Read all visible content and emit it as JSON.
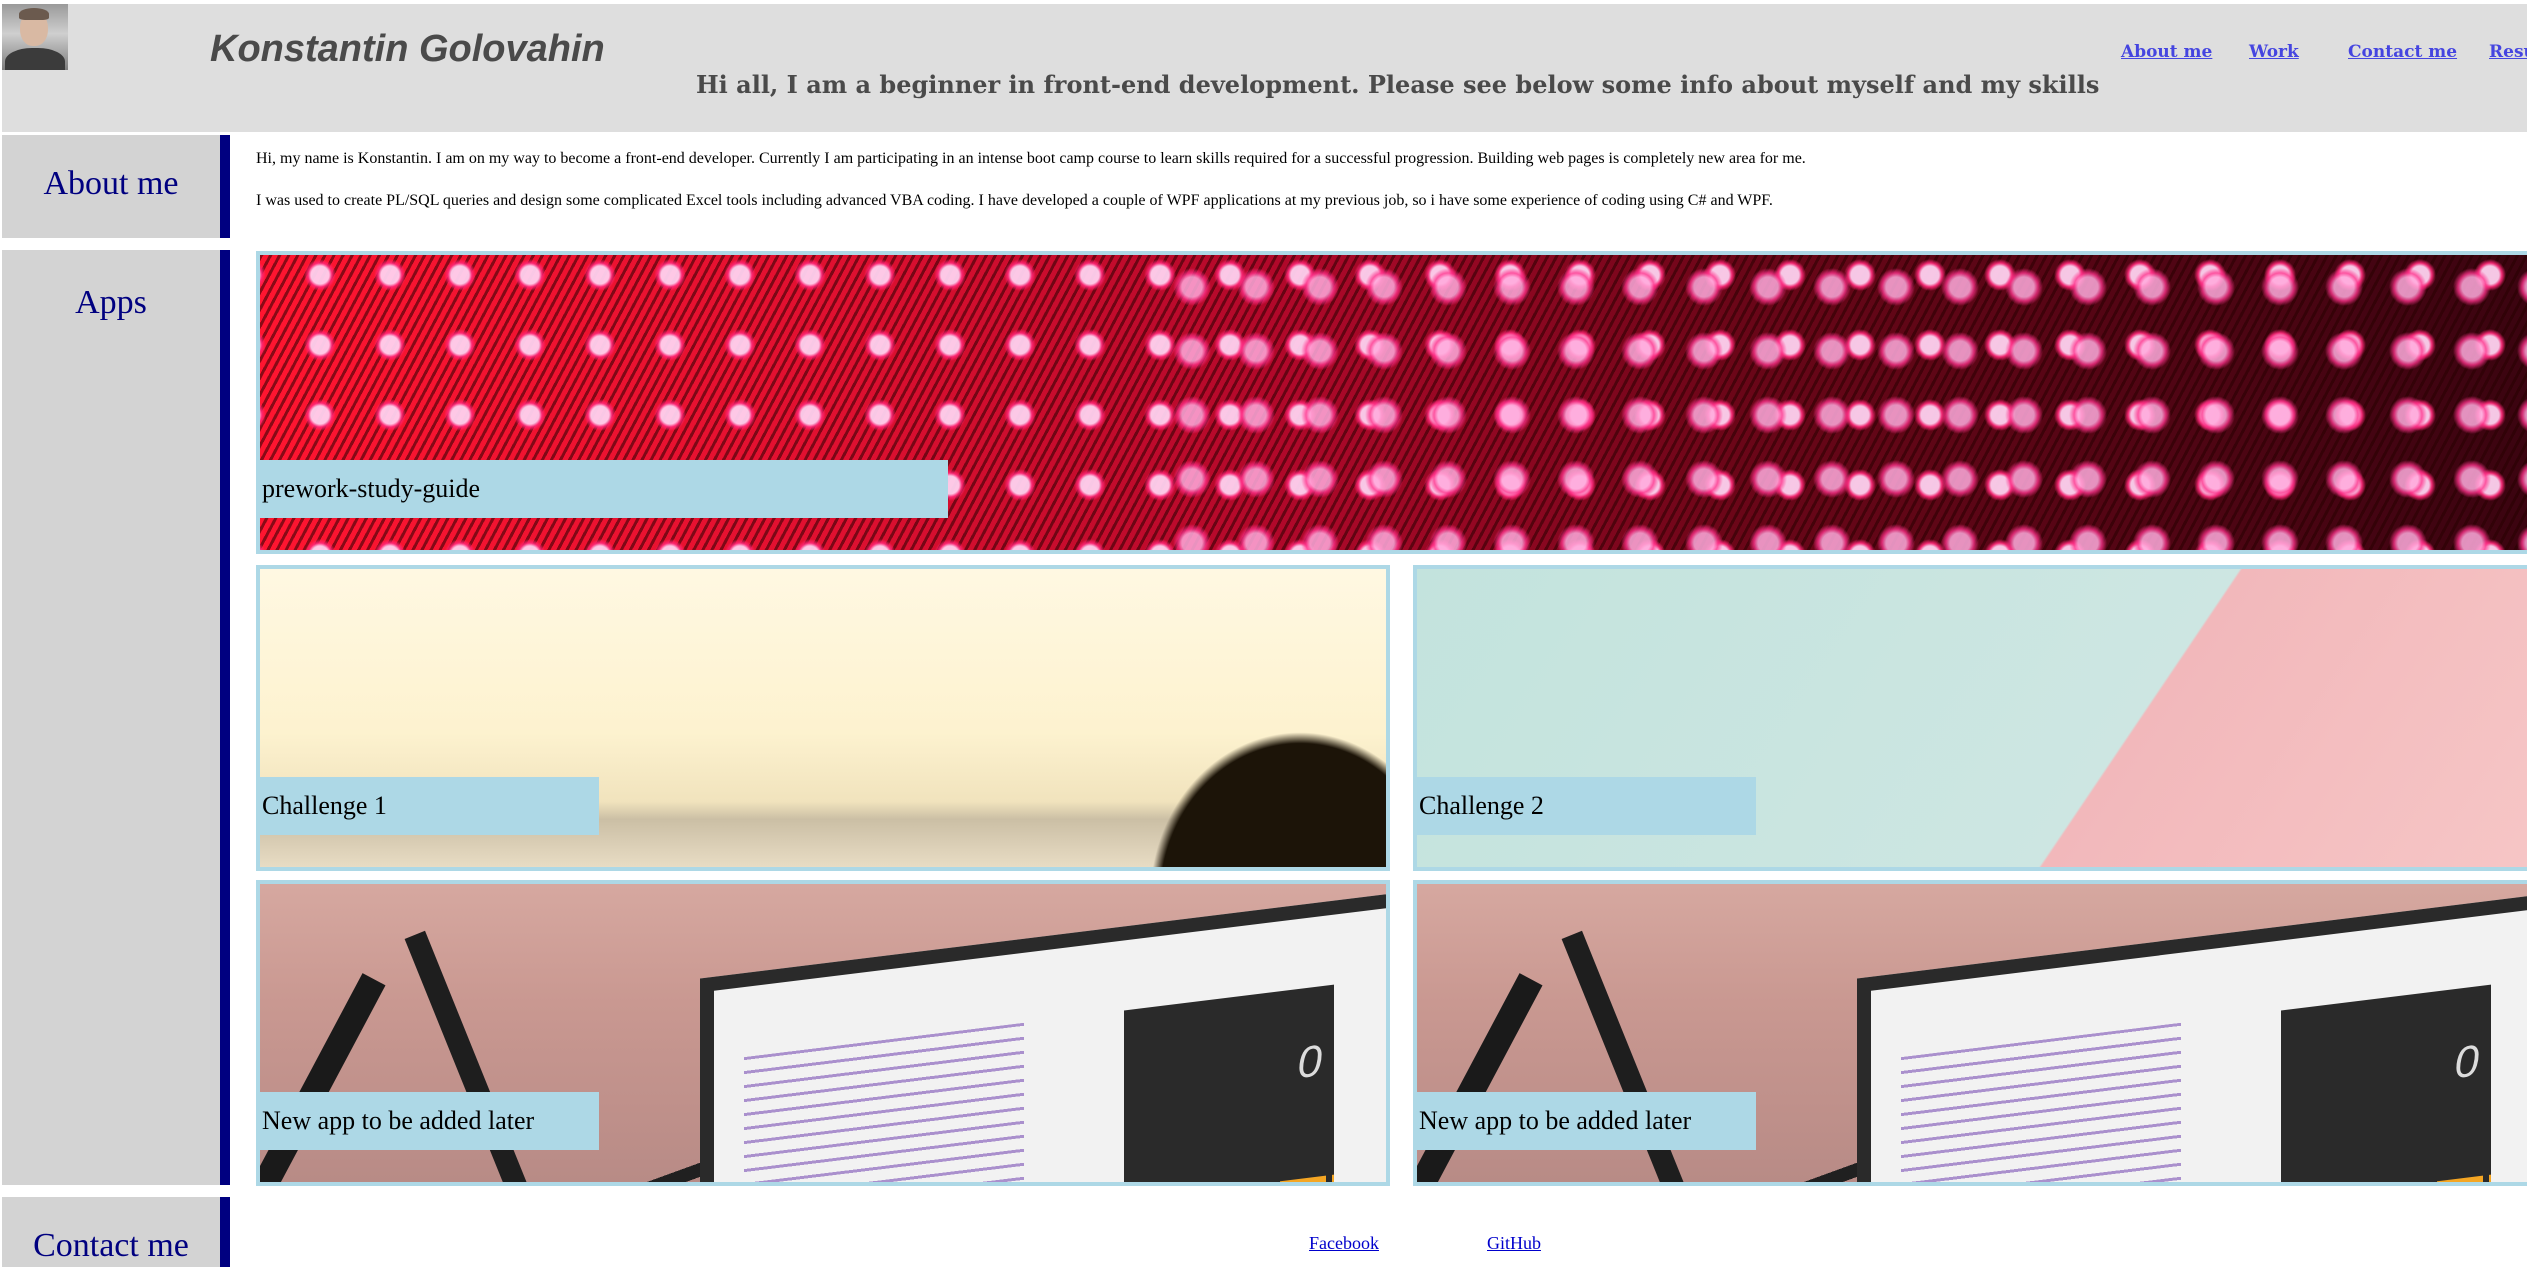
{
  "header": {
    "name": "Konstantin Golovahin",
    "tagline": "Hi all, I am a beginner in front-end development. Please see below some info about myself and my skills",
    "nav": {
      "about": "About me",
      "work": "Work",
      "contact": "Contact me",
      "resume": "Resu"
    }
  },
  "about": {
    "heading": "About me",
    "paragraphs": [
      "Hi, my name is Konstantin. I am on my way to become a front-end developer. Currently I am participating in an intense boot camp course to learn skills required for a successful progression. Building web pages is completely new area for me.",
      "I was used to create PL/SQL queries and design some complicated Excel tools including advanced VBA coding. I have developed a couple of WPF applications at my previous job, so i have some experience of coding using C# and WPF."
    ]
  },
  "apps": {
    "heading": "Apps",
    "cards": [
      {
        "caption": "prework-study-guide",
        "image": "red-led-lights"
      },
      {
        "caption": "Challenge 1",
        "image": "sunset-horizon"
      },
      {
        "caption": "Challenge 2",
        "image": "teal-pink-split"
      },
      {
        "caption": "New app to be added later",
        "image": "laptop-calculator-app",
        "calc_display": "0"
      },
      {
        "caption": "New app to be added later",
        "image": "laptop-calculator-app",
        "calc_display": "0"
      }
    ]
  },
  "contact": {
    "heading": "Contact me",
    "links": {
      "facebook": "Facebook",
      "github": "GitHub"
    }
  },
  "colors": {
    "side_panel": "#d3d3d3",
    "side_text": "#000080",
    "accent_border": "#000080",
    "caption_bg": "#add8e6",
    "header_bg": "#dedede"
  }
}
